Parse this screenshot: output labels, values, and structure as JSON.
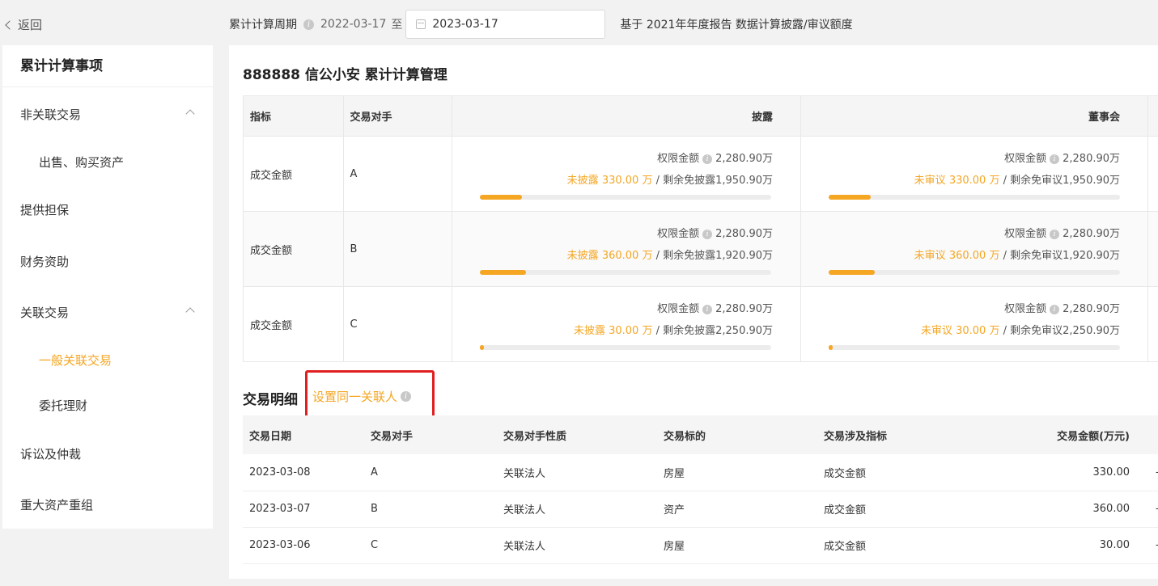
{
  "nav": {
    "back_label": "返回"
  },
  "topbar": {
    "period_label": "累计计算周期",
    "start_date": "2022-03-17",
    "to_label": "至",
    "end_date": "2023-03-17",
    "basis_text": "基于 2021年年度报告 数据计算披露/审议额度"
  },
  "sidebar": {
    "title": "累计计算事项",
    "items": [
      {
        "label": "非关联交易"
      },
      {
        "label": "出售、购买资产"
      },
      {
        "label": "提供担保"
      },
      {
        "label": "财务资助"
      },
      {
        "label": "关联交易"
      },
      {
        "label": "一般关联交易"
      },
      {
        "label": "委托理财"
      },
      {
        "label": "诉讼及仲裁"
      },
      {
        "label": "重大资产重组"
      }
    ]
  },
  "main": {
    "title": "888888 信公小安 累计计算管理",
    "cum_table": {
      "headers": [
        "指标",
        "交易对手",
        "披露",
        "董事会"
      ],
      "limit_label": "权限金额",
      "rows": [
        {
          "metric": "成交金额",
          "party": "A",
          "disclose": {
            "limit": "2,280.90万",
            "used_label": "未披露",
            "used": "330.00 万",
            "remain_label": "剩余免披露",
            "remain": "1,950.90万",
            "fraction": 0.1447
          },
          "board": {
            "limit": "2,280.90万",
            "used_label": "未审议",
            "used": "330.00 万",
            "remain_label": "剩余免审议",
            "remain": "1,950.90万",
            "fraction": 0.1447
          }
        },
        {
          "metric": "成交金额",
          "party": "B",
          "disclose": {
            "limit": "2,280.90万",
            "used_label": "未披露",
            "used": "360.00 万",
            "remain_label": "剩余免披露",
            "remain": "1,920.90万",
            "fraction": 0.1578
          },
          "board": {
            "limit": "2,280.90万",
            "used_label": "未审议",
            "used": "360.00 万",
            "remain_label": "剩余免审议",
            "remain": "1,920.90万",
            "fraction": 0.1578
          }
        },
        {
          "metric": "成交金额",
          "party": "C",
          "disclose": {
            "limit": "2,280.90万",
            "used_label": "未披露",
            "used": "30.00 万",
            "remain_label": "剩余免披露",
            "remain": "2,250.90万",
            "fraction": 0.0132
          },
          "board": {
            "limit": "2,280.90万",
            "used_label": "未审议",
            "used": "30.00 万",
            "remain_label": "剩余免审议",
            "remain": "2,250.90万",
            "fraction": 0.0132
          }
        }
      ]
    },
    "detail": {
      "title": "交易明细",
      "set_related_link": "设置同一关联人",
      "headers": [
        "交易日期",
        "交易对手",
        "交易对手性质",
        "交易标的",
        "交易涉及指标",
        "交易金额(万元)"
      ],
      "rows": [
        {
          "date": "2023-03-08",
          "party": "A",
          "nature": "关联法人",
          "subject": "房屋",
          "metric": "成交金额",
          "amount": "330.00"
        },
        {
          "date": "2023-03-07",
          "party": "B",
          "nature": "关联法人",
          "subject": "资产",
          "metric": "成交金额",
          "amount": "360.00"
        },
        {
          "date": "2023-03-06",
          "party": "C",
          "nature": "关联法人",
          "subject": "房屋",
          "metric": "成交金额",
          "amount": "30.00"
        }
      ]
    }
  },
  "colors": {
    "accent": "#f5a623",
    "highlight_box": "#e02020"
  }
}
